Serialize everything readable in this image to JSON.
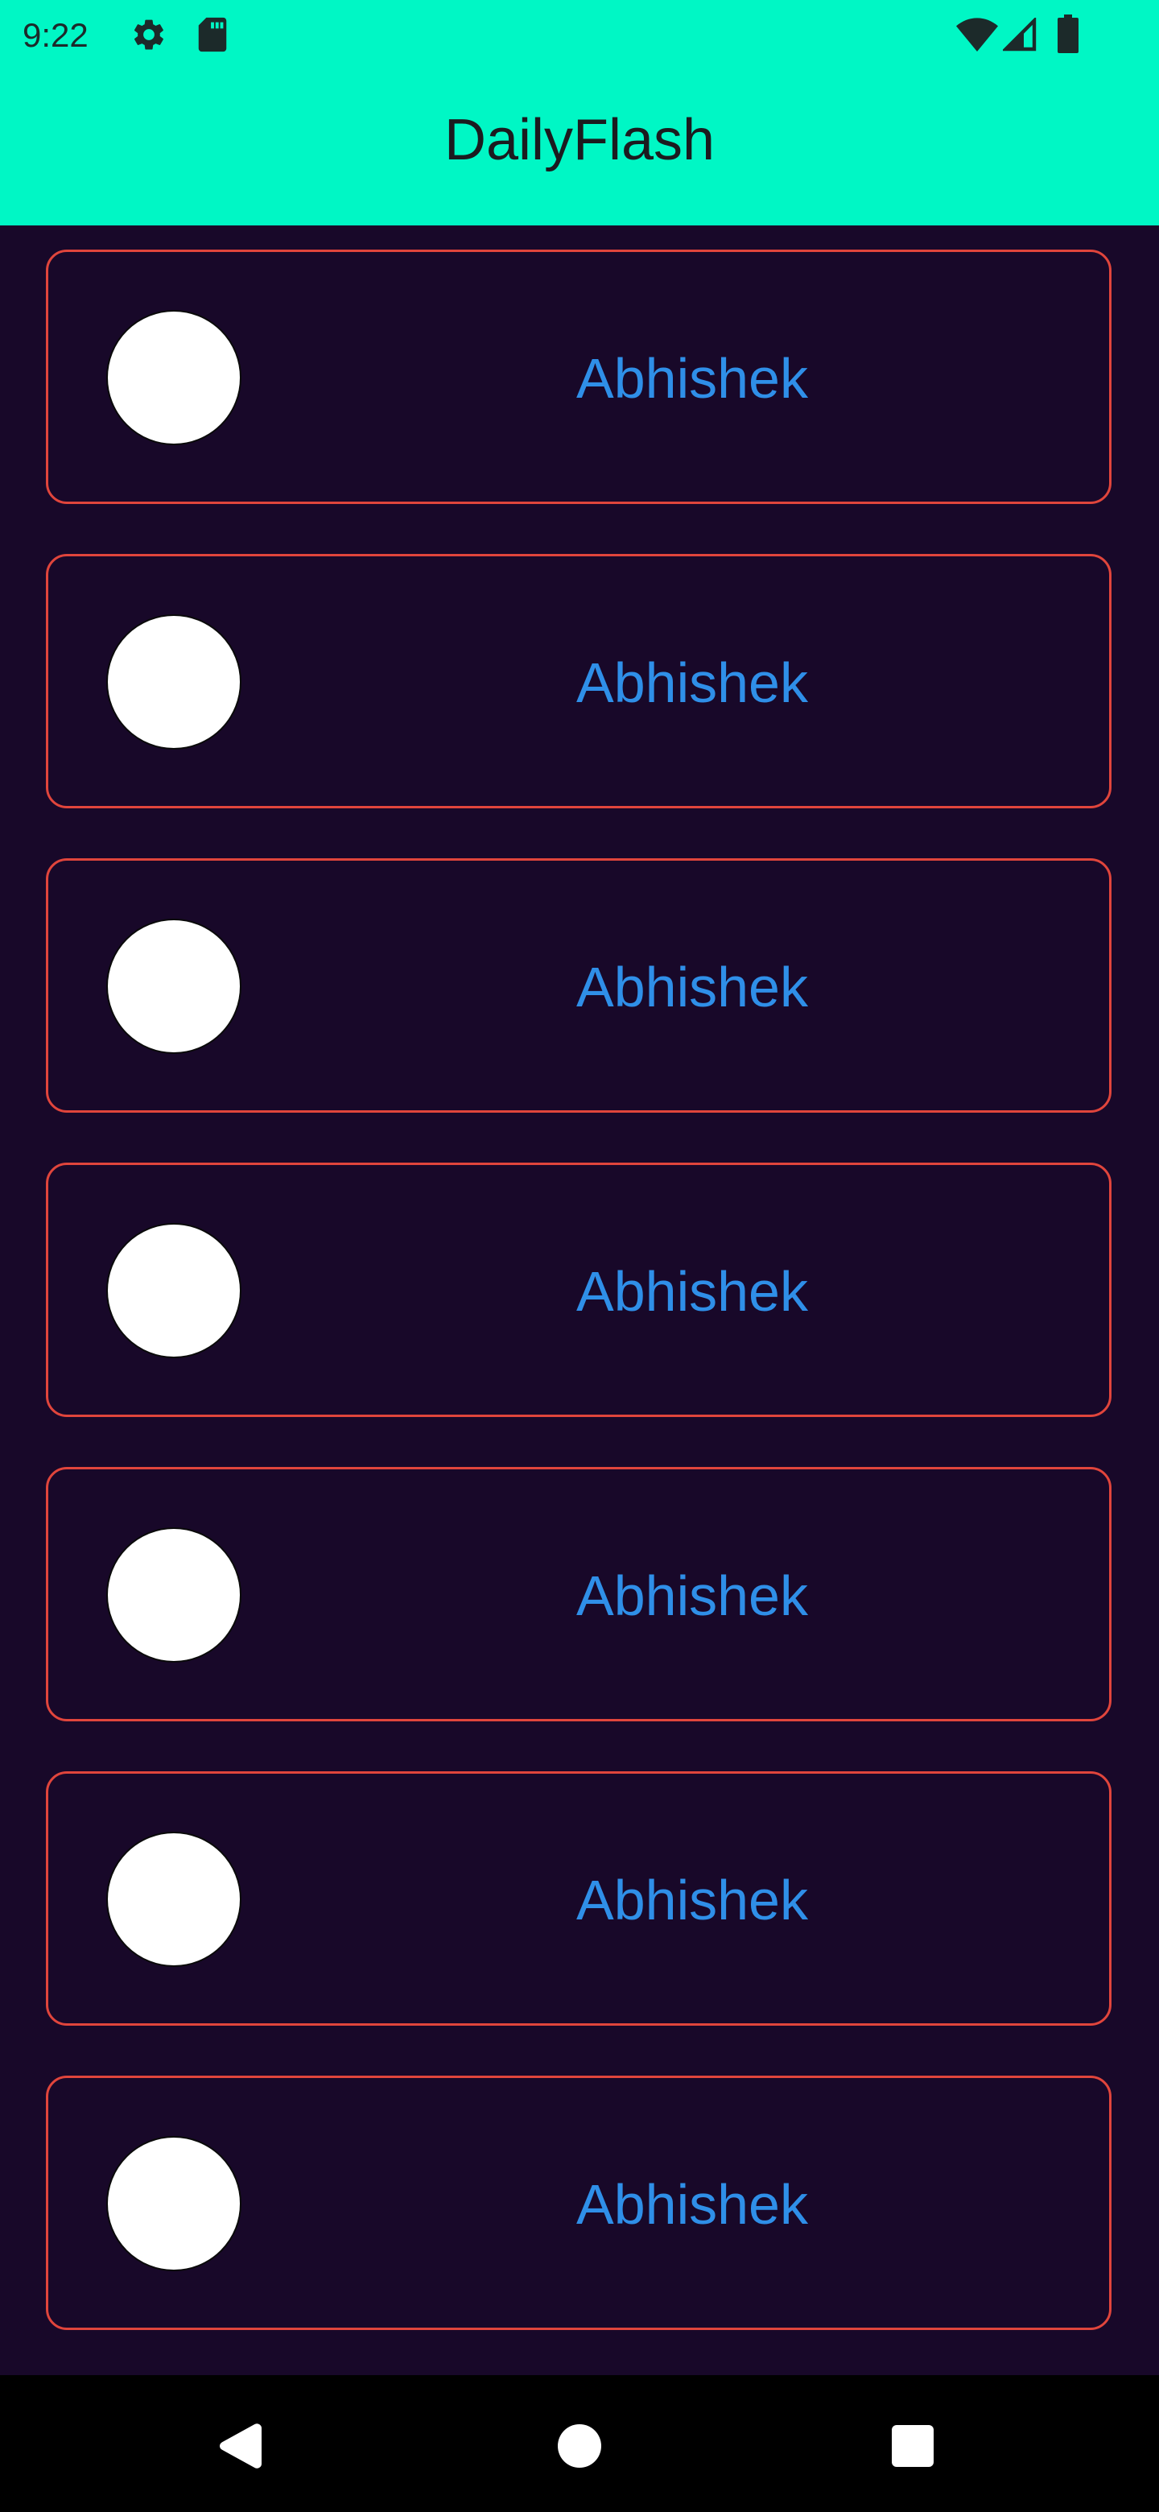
{
  "status_bar": {
    "time": "9:22",
    "icons": [
      "settings-icon",
      "sd-card-icon",
      "wifi-icon",
      "signal-icon",
      "battery-icon"
    ]
  },
  "app_bar": {
    "title": "DailyFlash",
    "background_color": "#00f7c5"
  },
  "list": {
    "items": [
      {
        "name": "Abhishek"
      },
      {
        "name": "Abhishek"
      },
      {
        "name": "Abhishek"
      },
      {
        "name": "Abhishek"
      },
      {
        "name": "Abhishek"
      },
      {
        "name": "Abhishek"
      },
      {
        "name": "Abhishek"
      }
    ]
  },
  "colors": {
    "page_background": "#180829",
    "card_border": "#e0453c",
    "name_text": "#2f8fe8",
    "avatar_fill": "#ffffff"
  },
  "nav_bar": {
    "buttons": [
      "back-icon",
      "home-icon",
      "recents-icon"
    ]
  }
}
